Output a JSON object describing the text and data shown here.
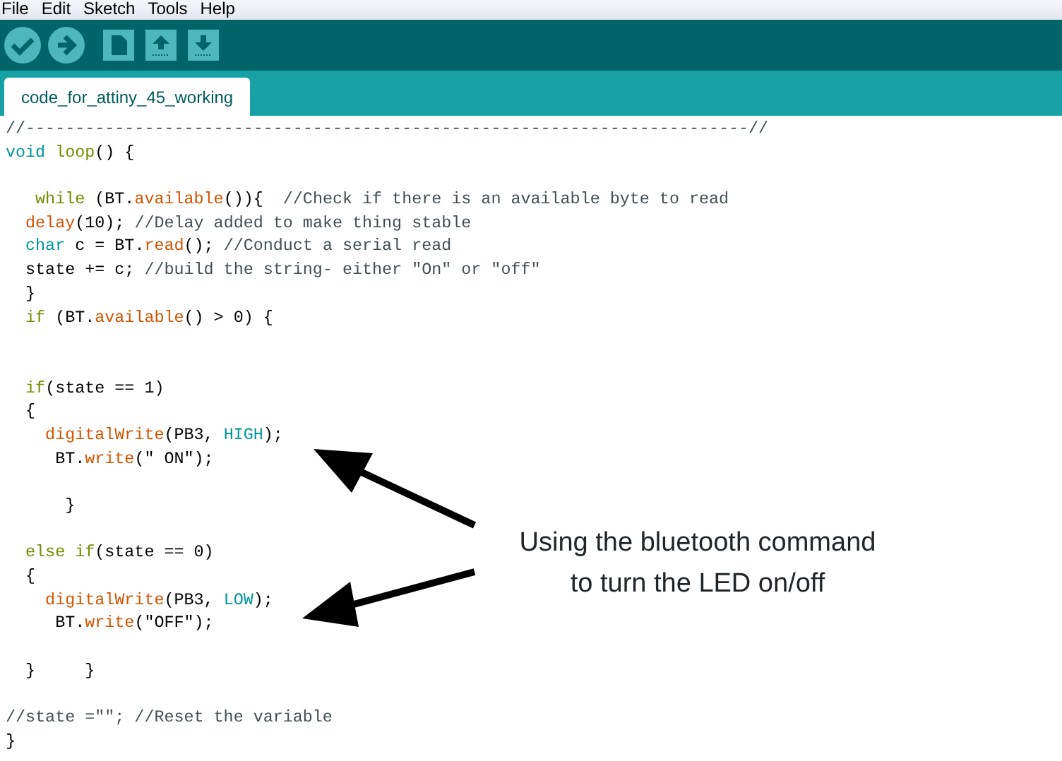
{
  "menu": [
    "File",
    "Edit",
    "Sketch",
    "Tools",
    "Help"
  ],
  "tabs": [
    {
      "label": "code_for_attiny_45_working",
      "selected": true
    }
  ],
  "code_lines": [
    {
      "kind": "code",
      "segments": [
        {
          "kind": "comment",
          "text": "//-------------------------------------------------------------------------//"
        }
      ]
    },
    {
      "kind": "code",
      "segments": [
        {
          "kind": "type",
          "text": "void "
        },
        {
          "kind": "control",
          "text": "loop"
        },
        {
          "kind": "plain",
          "text": "() {"
        }
      ]
    },
    {
      "kind": "blank"
    },
    {
      "kind": "code",
      "segments": [
        {
          "kind": "control",
          "text": "   while"
        },
        {
          "kind": "plain",
          "text": " (BT."
        },
        {
          "kind": "function",
          "text": "available"
        },
        {
          "kind": "plain",
          "text": "()){  "
        },
        {
          "kind": "comment",
          "text": "//Check if there is an available byte to read"
        }
      ]
    },
    {
      "kind": "code",
      "segments": [
        {
          "kind": "function",
          "text": "  delay"
        },
        {
          "kind": "plain",
          "text": "(10); "
        },
        {
          "kind": "comment",
          "text": "//Delay added to make thing stable"
        }
      ]
    },
    {
      "kind": "code",
      "segments": [
        {
          "kind": "type",
          "text": "  char"
        },
        {
          "kind": "plain",
          "text": " c = BT."
        },
        {
          "kind": "function",
          "text": "read"
        },
        {
          "kind": "plain",
          "text": "(); "
        },
        {
          "kind": "comment",
          "text": "//Conduct a serial read"
        }
      ]
    },
    {
      "kind": "code",
      "segments": [
        {
          "kind": "plain",
          "text": "  state += c; "
        },
        {
          "kind": "comment",
          "text": "//build the string- either \"On\" or \"off\""
        }
      ]
    },
    {
      "kind": "code",
      "segments": [
        {
          "kind": "plain",
          "text": "  }"
        }
      ]
    },
    {
      "kind": "code",
      "segments": [
        {
          "kind": "control",
          "text": "  if"
        },
        {
          "kind": "plain",
          "text": " (BT."
        },
        {
          "kind": "function",
          "text": "available"
        },
        {
          "kind": "plain",
          "text": "() > 0) {"
        }
      ]
    },
    {
      "kind": "blank"
    },
    {
      "kind": "blank"
    },
    {
      "kind": "code",
      "segments": [
        {
          "kind": "control",
          "text": "  if"
        },
        {
          "kind": "plain",
          "text": "(state == 1)"
        }
      ]
    },
    {
      "kind": "code",
      "segments": [
        {
          "kind": "plain",
          "text": "  {"
        }
      ]
    },
    {
      "kind": "code",
      "segments": [
        {
          "kind": "function",
          "text": "    digitalWrite"
        },
        {
          "kind": "plain",
          "text": "(PB3, "
        },
        {
          "kind": "type",
          "text": "HIGH"
        },
        {
          "kind": "plain",
          "text": ");"
        }
      ]
    },
    {
      "kind": "code",
      "segments": [
        {
          "kind": "plain",
          "text": "     BT."
        },
        {
          "kind": "function",
          "text": "write"
        },
        {
          "kind": "plain",
          "text": "(\" ON\");"
        }
      ]
    },
    {
      "kind": "blank"
    },
    {
      "kind": "code",
      "segments": [
        {
          "kind": "plain",
          "text": "      }"
        }
      ]
    },
    {
      "kind": "blank"
    },
    {
      "kind": "code",
      "segments": [
        {
          "kind": "control",
          "text": "  else if"
        },
        {
          "kind": "plain",
          "text": "(state == 0)"
        }
      ]
    },
    {
      "kind": "code",
      "segments": [
        {
          "kind": "plain",
          "text": "  {"
        }
      ]
    },
    {
      "kind": "code",
      "segments": [
        {
          "kind": "function",
          "text": "    digitalWrite"
        },
        {
          "kind": "plain",
          "text": "(PB3, "
        },
        {
          "kind": "type",
          "text": "LOW"
        },
        {
          "kind": "plain",
          "text": ");"
        }
      ]
    },
    {
      "kind": "code",
      "segments": [
        {
          "kind": "plain",
          "text": "     BT."
        },
        {
          "kind": "function",
          "text": "write"
        },
        {
          "kind": "plain",
          "text": "(\"OFF\");"
        }
      ]
    },
    {
      "kind": "blank"
    },
    {
      "kind": "code",
      "segments": [
        {
          "kind": "plain",
          "text": "  }     }"
        }
      ]
    },
    {
      "kind": "blank"
    },
    {
      "kind": "code",
      "segments": [
        {
          "kind": "comment",
          "text": "//state =\"\"; //Reset the variable"
        }
      ]
    },
    {
      "kind": "code",
      "segments": [
        {
          "kind": "plain",
          "text": "}"
        }
      ]
    }
  ],
  "annotation": {
    "lines": [
      "Using the bluetooth command",
      "to turn the LED on/off"
    ]
  }
}
